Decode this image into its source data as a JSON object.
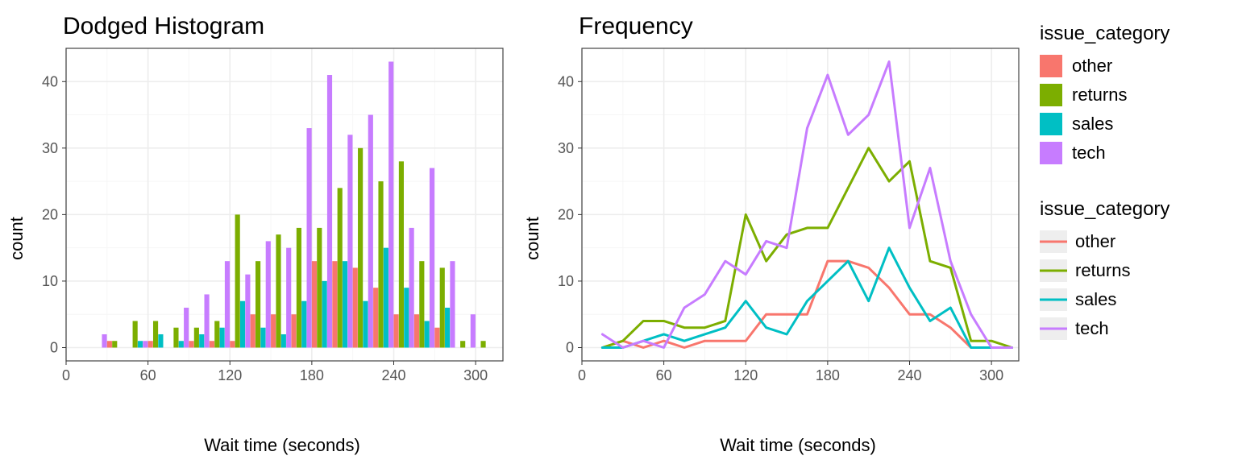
{
  "colors": {
    "other": "#F8766D",
    "returns": "#7CAE00",
    "sales": "#00BFC4",
    "tech": "#C77CFF",
    "panel_bg": "#ffffff",
    "panel_border": "#444",
    "grid": "#EDEDED",
    "grid_minor": "#F6F6F6"
  },
  "axes": {
    "xlabel": "Wait time (seconds)",
    "ylabel": "count",
    "x_ticks": [
      0,
      60,
      120,
      180,
      240,
      300
    ],
    "y_ticks": [
      0,
      10,
      20,
      30,
      40
    ],
    "xlim": [
      0,
      320
    ],
    "ylim": [
      -2,
      45
    ]
  },
  "panel1": {
    "title": "Dodged Histogram"
  },
  "panel2": {
    "title": "Frequency"
  },
  "legend": {
    "title": "issue_category",
    "items": [
      "other",
      "returns",
      "sales",
      "tech"
    ]
  },
  "chart_data": [
    {
      "type": "bar",
      "title": "Dodged Histogram",
      "xlabel": "Wait time (seconds)",
      "ylabel": "count",
      "xlim": [
        0,
        320
      ],
      "ylim": [
        0,
        45
      ],
      "bin_width": 15,
      "bin_left_edges": [
        15,
        30,
        45,
        60,
        75,
        90,
        105,
        120,
        135,
        150,
        165,
        180,
        195,
        210,
        225,
        240,
        255,
        270,
        285,
        300
      ],
      "series": [
        {
          "name": "other",
          "values": [
            0,
            1,
            0,
            1,
            0,
            1,
            1,
            1,
            5,
            5,
            5,
            13,
            13,
            12,
            9,
            5,
            5,
            3,
            0,
            0
          ]
        },
        {
          "name": "returns",
          "values": [
            0,
            1,
            4,
            4,
            3,
            3,
            4,
            20,
            13,
            17,
            18,
            18,
            24,
            30,
            25,
            28,
            13,
            12,
            1,
            1
          ]
        },
        {
          "name": "sales",
          "values": [
            0,
            0,
            1,
            2,
            1,
            2,
            3,
            7,
            3,
            2,
            7,
            10,
            13,
            7,
            15,
            9,
            4,
            6,
            0,
            0
          ]
        },
        {
          "name": "tech",
          "values": [
            2,
            0,
            1,
            0,
            6,
            8,
            13,
            11,
            16,
            15,
            33,
            41,
            32,
            35,
            43,
            18,
            27,
            13,
            5,
            0
          ]
        }
      ]
    },
    {
      "type": "line",
      "title": "Frequency",
      "xlabel": "Wait time (seconds)",
      "ylabel": "count",
      "xlim": [
        0,
        320
      ],
      "ylim": [
        0,
        45
      ],
      "x": [
        15,
        30,
        45,
        60,
        75,
        90,
        105,
        120,
        135,
        150,
        165,
        180,
        195,
        210,
        225,
        240,
        255,
        270,
        285,
        300,
        315
      ],
      "series": [
        {
          "name": "other",
          "values": [
            0,
            1,
            0,
            1,
            0,
            1,
            1,
            1,
            5,
            5,
            5,
            13,
            13,
            12,
            9,
            5,
            5,
            3,
            0,
            0,
            0
          ]
        },
        {
          "name": "returns",
          "values": [
            0,
            1,
            4,
            4,
            3,
            3,
            4,
            20,
            13,
            17,
            18,
            18,
            24,
            30,
            25,
            28,
            13,
            12,
            1,
            1,
            0
          ]
        },
        {
          "name": "sales",
          "values": [
            0,
            0,
            1,
            2,
            1,
            2,
            3,
            7,
            3,
            2,
            7,
            10,
            13,
            7,
            15,
            9,
            4,
            6,
            0,
            0,
            0
          ]
        },
        {
          "name": "tech",
          "values": [
            2,
            0,
            1,
            0,
            6,
            8,
            13,
            11,
            16,
            15,
            33,
            41,
            32,
            35,
            43,
            18,
            27,
            13,
            5,
            0,
            0
          ]
        }
      ]
    }
  ]
}
